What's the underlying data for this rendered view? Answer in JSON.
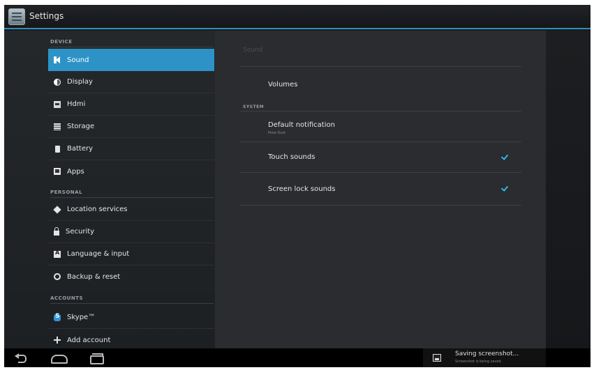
{
  "app": {
    "title": "Settings"
  },
  "sidebar": {
    "sections": [
      {
        "label": "DEVICE"
      },
      {
        "label": "PERSONAL"
      },
      {
        "label": "ACCOUNTS"
      }
    ],
    "items": [
      {
        "label": "Sound",
        "icon": "speaker-icon",
        "selected": true
      },
      {
        "label": "Display",
        "icon": "display-icon"
      },
      {
        "label": "Hdmi",
        "icon": "hdmi-icon"
      },
      {
        "label": "Storage",
        "icon": "storage-icon"
      },
      {
        "label": "Battery",
        "icon": "battery-icon"
      },
      {
        "label": "Apps",
        "icon": "apps-icon"
      },
      {
        "label": "Location services",
        "icon": "location-icon"
      },
      {
        "label": "Security",
        "icon": "lock-icon"
      },
      {
        "label": "Language & input",
        "icon": "language-icon"
      },
      {
        "label": "Backup & reset",
        "icon": "backup-icon"
      },
      {
        "label": "Skype™",
        "icon": "skype-icon"
      },
      {
        "label": "Add account",
        "icon": "add-icon"
      }
    ]
  },
  "detail": {
    "heading": "Sound",
    "volumes": "Volumes",
    "system_section": "SYSTEM",
    "default_notification": {
      "title": "Default notification",
      "summary": "Pixie Dust"
    },
    "touch_sounds": {
      "title": "Touch sounds",
      "checked": true
    },
    "screen_lock_sounds": {
      "title": "Screen lock sounds",
      "checked": true
    },
    "accent_color": "#33b5e5"
  },
  "system_bar": {
    "notification": {
      "title": "Saving screenshot...",
      "subtitle": "Screenshot is being saved."
    }
  }
}
